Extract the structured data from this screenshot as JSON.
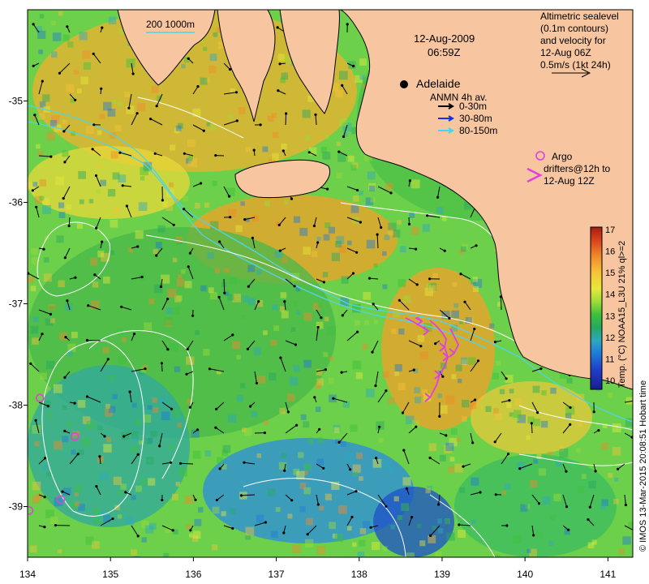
{
  "map": {
    "region": "South Australia coast, Adelaide to Portland",
    "date": "12-Aug-2009",
    "time": "06:59Z",
    "scale_bar": "200  1000m",
    "place_label": "Adelaide",
    "x_ticks": [
      "134",
      "135",
      "136",
      "137",
      "138",
      "139",
      "140",
      "141"
    ],
    "y_ticks": [
      "-35",
      "-36",
      "-37",
      "-38",
      "-39"
    ],
    "lon_range": [
      134,
      141.3
    ],
    "lat_range": [
      -39.5,
      -34.1
    ],
    "colors": {
      "land": "#f7c6a0",
      "coast_line": "#000000",
      "contour": "#ffffff",
      "bathy": "#4fd4e8"
    }
  },
  "legend": {
    "altimetry": [
      "Altimetric sealevel",
      "(0.1m contours)",
      "and velocity for",
      "12-Aug 06Z",
      "0.5m/s (1kt 24h)"
    ],
    "anmn_title": "ANMN 4h av.",
    "anmn_items": [
      {
        "label": "0-30m",
        "color": "#000000"
      },
      {
        "label": "30-80m",
        "color": "#1a2ee6"
      },
      {
        "label": "80-150m",
        "color": "#3fd8f0"
      }
    ],
    "argo_label": "Argo",
    "drifter_lines": [
      "drifters@12h to",
      "12-Aug 12Z"
    ],
    "argo_color": "#e040e0"
  },
  "colorbar": {
    "ticks": [
      "17",
      "16",
      "15",
      "14",
      "13",
      "12",
      "11",
      "10"
    ],
    "label": "Temp. (°C) NOAA15_L3U 21% ql>=2",
    "colors": [
      "#a51e12",
      "#d8421c",
      "#f08a2a",
      "#f7c43a",
      "#e6e83a",
      "#9ddc3a",
      "#3cc03c",
      "#26a860",
      "#2ca8c0",
      "#1e7ad8",
      "#1e3ec8",
      "#1a1e90"
    ]
  },
  "credit": "© IMOS 13-Mar-2015 20:08:51 Hobart time",
  "argo_floats": [
    {
      "lon": 134.15,
      "lat": -37.93
    },
    {
      "lon": 134.57,
      "lat": -38.31
    },
    {
      "lon": 134.4,
      "lat": -38.93
    },
    {
      "lon": 134.02,
      "lat": -39.04
    }
  ]
}
